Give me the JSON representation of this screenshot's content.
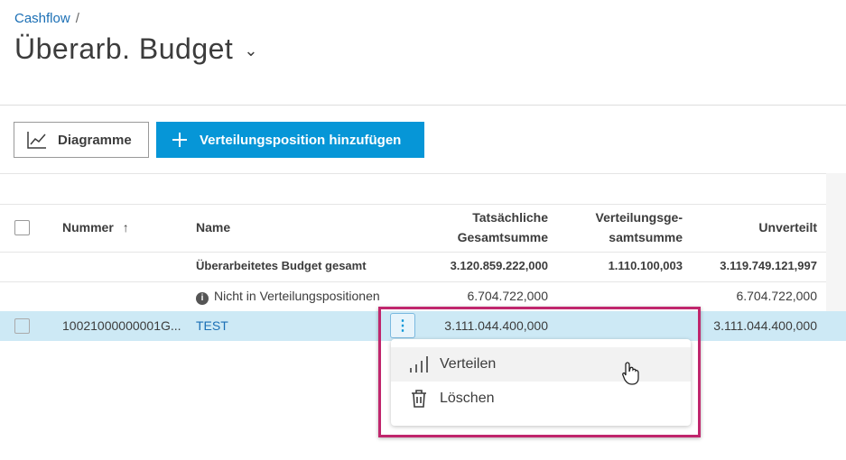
{
  "breadcrumb": {
    "parent": "Cashflow",
    "separator": "/"
  },
  "title": "Überarb. Budget",
  "toolbar": {
    "charts_label": "Diagramme",
    "add_label": "Verteilungsposition hinzufügen"
  },
  "table": {
    "headers": {
      "number": "Nummer",
      "name": "Name",
      "actual_l1": "Tatsächliche",
      "actual_l2": "Gesamtsumme",
      "dist_l1": "Verteilungsge-",
      "dist_l2": "samtsumme",
      "undistributed": "Unverteilt"
    },
    "total_row": {
      "name": "Überarbeitetes Budget gesamt",
      "actual": "3.120.859.222,000",
      "dist": "1.110.100,003",
      "undistributed": "3.119.749.121,997"
    },
    "info_row": {
      "name": "Nicht in Verteilungspositionen",
      "actual": "6.704.722,000",
      "undistributed": "6.704.722,000"
    },
    "rows": [
      {
        "number": "10021000000001G...",
        "name": "TEST",
        "actual": "3.111.044.400,000",
        "undistributed": "3.111.044.400,000"
      }
    ]
  },
  "context_menu": {
    "items": [
      {
        "label": "Verteilen",
        "icon": "bar-chart-icon"
      },
      {
        "label": "Löschen",
        "icon": "trash-icon"
      }
    ]
  },
  "colors": {
    "accent": "#0696d7",
    "highlight": "#c0266d",
    "selected_row": "#cde9f5"
  }
}
